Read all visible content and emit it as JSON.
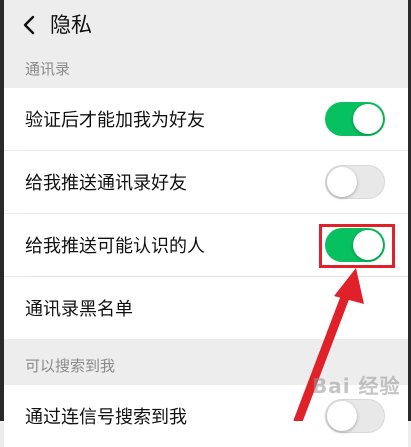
{
  "header": {
    "title": "隐私",
    "back_icon": "chevron-left-icon"
  },
  "sections": {
    "contacts_label": "通讯录",
    "searchable_label": "可以搜索到我"
  },
  "rows": {
    "verify_friend": {
      "label": "验证后才能加我为好友",
      "enabled": true
    },
    "push_contacts": {
      "label": "给我推送通讯录好友",
      "enabled": false
    },
    "push_people": {
      "label": "给我推送可能认识的人",
      "enabled": true
    },
    "blacklist": {
      "label": "通讯录黑名单"
    },
    "search_by_id": {
      "label": "通过连信号搜索到我",
      "enabled": false
    }
  },
  "colors": {
    "toggle_on": "#07c160",
    "annotation": "#e0212a"
  },
  "watermark": "Bai 经验"
}
